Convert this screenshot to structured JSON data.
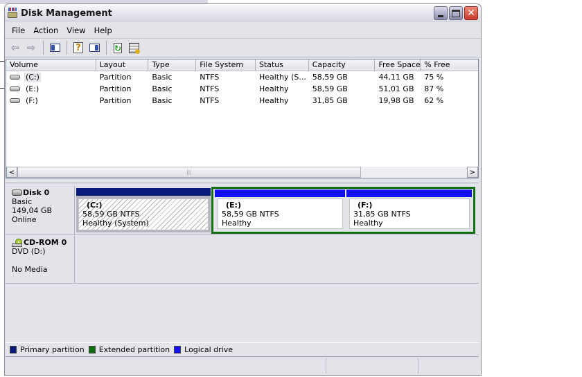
{
  "window": {
    "title": "Disk Management"
  },
  "menu": [
    "File",
    "Action",
    "View",
    "Help"
  ],
  "toolbar": {
    "buttons": [
      "back-icon",
      "forward-icon",
      "show-hide-console-tree-icon",
      "help-icon",
      "show-hide-action-pane-icon",
      "refresh-icon",
      "properties-icon"
    ]
  },
  "volume_list": {
    "columns": [
      "Volume",
      "Layout",
      "Type",
      "File System",
      "Status",
      "Capacity",
      "Free Space",
      "% Free"
    ],
    "rows": [
      {
        "volume": "(C:)",
        "layout": "Partition",
        "type": "Basic",
        "fs": "NTFS",
        "status": "Healthy (S...",
        "capacity": "58,59 GB",
        "free": "44,11 GB",
        "pct": "75 %"
      },
      {
        "volume": "(E:)",
        "layout": "Partition",
        "type": "Basic",
        "fs": "NTFS",
        "status": "Healthy",
        "capacity": "58,59 GB",
        "free": "51,01 GB",
        "pct": "87 %"
      },
      {
        "volume": "(F:)",
        "layout": "Partition",
        "type": "Basic",
        "fs": "NTFS",
        "status": "Healthy",
        "capacity": "31,85 GB",
        "free": "19,98 GB",
        "pct": "62 %"
      }
    ]
  },
  "disks": [
    {
      "name": "Disk 0",
      "kind": "Basic",
      "size": "149,04 GB",
      "state": "Online",
      "partitions": [
        {
          "name": "(C:)",
          "size": "58,59 GB NTFS",
          "status": "Healthy (System)",
          "kind": "primary"
        },
        {
          "name": "(E:)",
          "size": "58,59 GB NTFS",
          "status": "Healthy",
          "kind": "logical"
        },
        {
          "name": "(F:)",
          "size": "31,85 GB NTFS",
          "status": "Healthy",
          "kind": "logical"
        }
      ]
    },
    {
      "name": "CD-ROM 0",
      "kind": "DVD (D:)",
      "size": "",
      "state": "No Media"
    }
  ],
  "legend": [
    {
      "label": "Primary partition",
      "color": "#0a1a7a"
    },
    {
      "label": "Extended partition",
      "color": "#107010"
    },
    {
      "label": "Logical drive",
      "color": "#1010f0"
    }
  ],
  "colors": {
    "primary": "#0a1a7a",
    "extended": "#107010",
    "logical": "#1010f0"
  }
}
